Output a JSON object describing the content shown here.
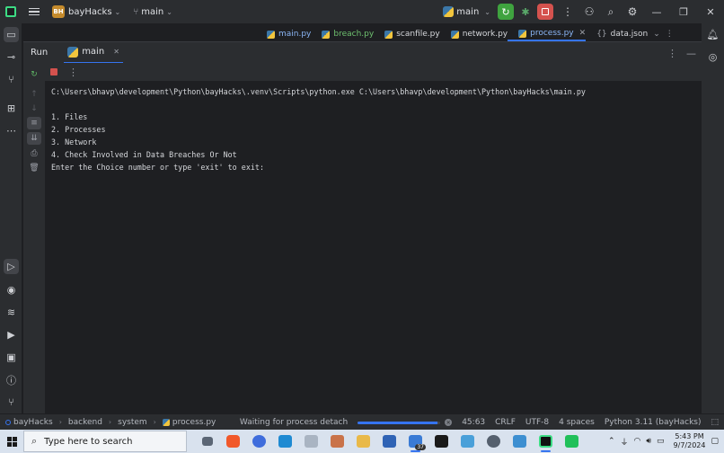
{
  "titlebar": {
    "project_badge": "BH",
    "project_name": "bayHacks",
    "branch": "main",
    "run_config": "main"
  },
  "editor_tabs": [
    {
      "label": "main.py",
      "kind": "mod"
    },
    {
      "label": "breach.py",
      "kind": "lib"
    },
    {
      "label": "scanfile.py",
      "kind": "plain"
    },
    {
      "label": "network.py",
      "kind": "plain"
    },
    {
      "label": "process.py",
      "kind": "mod",
      "active": true
    },
    {
      "label": "data.json",
      "kind": "plain"
    }
  ],
  "run_panel": {
    "title": "Run",
    "tab_label": "main"
  },
  "console": {
    "lines": [
      "C:\\Users\\bhavp\\development\\Python\\bayHacks\\.venv\\Scripts\\python.exe C:\\Users\\bhavp\\development\\Python\\bayHacks\\main.py",
      "",
      "1. Files",
      "2. Processes",
      "3. Network",
      "4. Check Involved in Data Breaches Or Not",
      "Enter the Choice number or type 'exit' to exit:"
    ]
  },
  "statusbar": {
    "breadcrumb": [
      "bayHacks",
      "backend",
      "system",
      "process.py"
    ],
    "task_text": "Waiting for process detach",
    "progress_fraction": 0.97,
    "position": "45:63",
    "line_ending": "CRLF",
    "encoding": "UTF-8",
    "indent": "4 spaces",
    "interpreter": "Python 3.11 (bayHacks)"
  },
  "taskbar": {
    "search_placeholder": "Type here to search",
    "badge_count": "37",
    "time": "5:43 PM",
    "date": "9/7/2024"
  }
}
